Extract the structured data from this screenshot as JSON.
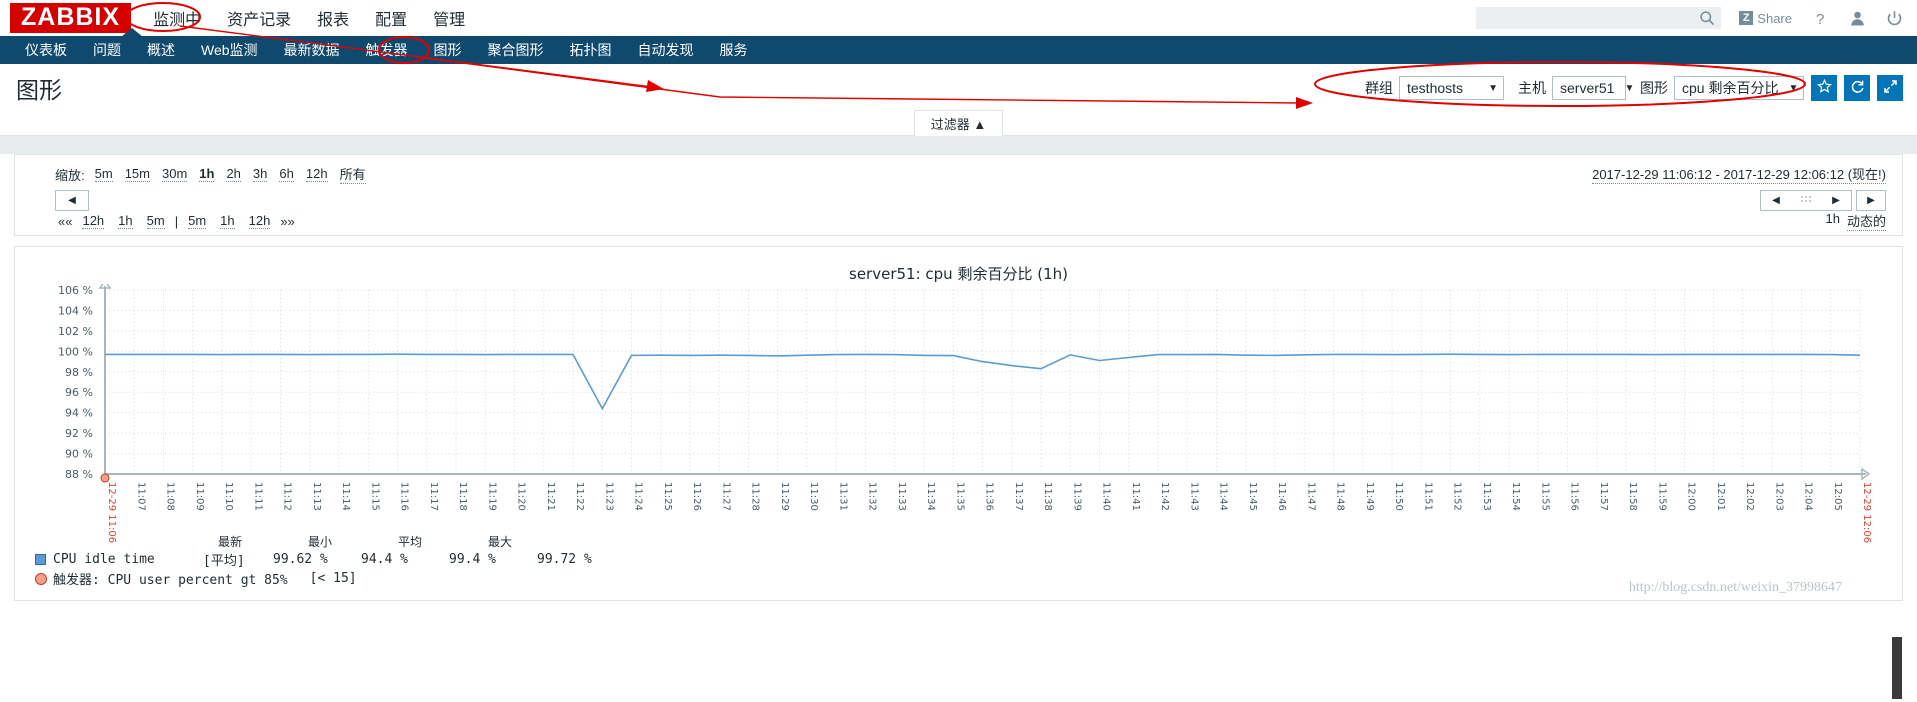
{
  "brand": {
    "logo": "ZABBIX"
  },
  "top_menu": [
    {
      "label": "监测中",
      "active": true,
      "name": "monitoring"
    },
    {
      "label": "资产记录",
      "active": false,
      "name": "inventory"
    },
    {
      "label": "报表",
      "active": false,
      "name": "reports"
    },
    {
      "label": "配置",
      "active": false,
      "name": "configuration"
    },
    {
      "label": "管理",
      "active": false,
      "name": "administration"
    }
  ],
  "search": {
    "value": "",
    "placeholder": ""
  },
  "share": {
    "label": "Share",
    "badge": "Z"
  },
  "sub_menu": [
    {
      "label": "仪表板",
      "active": false
    },
    {
      "label": "问题",
      "active": false
    },
    {
      "label": "概述",
      "active": false
    },
    {
      "label": "Web监测",
      "active": false
    },
    {
      "label": "最新数据",
      "active": false
    },
    {
      "label": "触发器",
      "active": false
    },
    {
      "label": "图形",
      "active": true
    },
    {
      "label": "聚合图形",
      "active": false
    },
    {
      "label": "拓扑图",
      "active": false
    },
    {
      "label": "自动发现",
      "active": false
    },
    {
      "label": "服务",
      "active": false
    }
  ],
  "page": {
    "title": "图形"
  },
  "filters": {
    "group": {
      "label": "群组",
      "value": "testhosts"
    },
    "host": {
      "label": "主机",
      "value": "server51"
    },
    "graph": {
      "label": "图形",
      "value": "cpu 剩余百分比"
    },
    "favorite_icon": "star-icon",
    "refresh_icon": "refresh-icon",
    "fullscreen_icon": "fullscreen-icon"
  },
  "filter_tab": {
    "label": "过滤器 ▲"
  },
  "timecontrol": {
    "zoom_label": "缩放:",
    "zoom_options": [
      {
        "label": "5m",
        "selected": false
      },
      {
        "label": "15m",
        "selected": false
      },
      {
        "label": "30m",
        "selected": false
      },
      {
        "label": "1h",
        "selected": true
      },
      {
        "label": "2h",
        "selected": false
      },
      {
        "label": "3h",
        "selected": false
      },
      {
        "label": "6h",
        "selected": false
      },
      {
        "label": "12h",
        "selected": false
      },
      {
        "label": "所有",
        "selected": false
      }
    ],
    "date_range": "2017-12-29 11:06:12 - 2017-12-29 12:06:12 (现在!)",
    "back_button": "◀",
    "quick_nav": [
      "««",
      "12h",
      "1h",
      "5m",
      "|",
      "5m",
      "1h",
      "12h",
      "»»"
    ],
    "scroll_left": "◀",
    "scroll_handle": "⋮⋮⋮",
    "scroll_right": "▶",
    "forward_button": "▶",
    "period": "1h",
    "dynamic_label": "动态的"
  },
  "graph": {
    "title": "server51: cpu 剩余百分比 (1h)",
    "legend_headers": [
      "最新",
      "最小",
      "平均",
      "最大"
    ],
    "series_row": {
      "name": "CPU idle time",
      "aggregate": "[平均]",
      "last": "99.62 %",
      "min": "94.4 %",
      "avg": "99.4 %",
      "max": "99.72 %"
    },
    "trigger_row": {
      "label": "触发器: CPU user percent gt 85%",
      "value": "[< 15]"
    }
  },
  "watermark": "http://blog.csdn.net/weixin_37998647",
  "chart_data": {
    "type": "line",
    "title": "server51: cpu 剩余百分比 (1h)",
    "xlabel": "",
    "ylabel": "%",
    "ylim": [
      88,
      106
    ],
    "grid": true,
    "legend_position": "bottom-left",
    "y_ticks": [
      "106 %",
      "104 %",
      "102 %",
      "100 %",
      "98 %",
      "96 %",
      "94 %",
      "92 %",
      "90 %",
      "88 %"
    ],
    "x_start_label": "12-29 11:06",
    "x_end_label": "12-29 12:06",
    "x_tick_labels": [
      "12-29 11:06",
      "11:07",
      "11:08",
      "11:09",
      "11:10",
      "11:11",
      "11:12",
      "11:13",
      "11:14",
      "11:15",
      "11:16",
      "11:17",
      "11:18",
      "11:19",
      "11:20",
      "11:21",
      "11:22",
      "11:23",
      "11:24",
      "11:25",
      "11:26",
      "11:27",
      "11:28",
      "11:29",
      "11:30",
      "11:31",
      "11:32",
      "11:33",
      "11:34",
      "11:35",
      "11:36",
      "11:37",
      "11:38",
      "11:39",
      "11:40",
      "11:41",
      "11:42",
      "11:43",
      "11:44",
      "11:45",
      "11:46",
      "11:47",
      "11:48",
      "11:49",
      "11:50",
      "11:51",
      "11:52",
      "11:53",
      "11:54",
      "11:55",
      "11:56",
      "11:57",
      "11:58",
      "11:59",
      "12:00",
      "12:01",
      "12:02",
      "12:03",
      "12:04",
      "12:05",
      "12-29 12:06"
    ],
    "series": [
      {
        "name": "CPU idle time",
        "color": "#5b9bd1",
        "values": [
          99.7,
          99.7,
          99.7,
          99.7,
          99.68,
          99.7,
          99.7,
          99.68,
          99.7,
          99.7,
          99.72,
          99.7,
          99.7,
          99.68,
          99.7,
          99.7,
          99.7,
          94.4,
          99.6,
          99.62,
          99.6,
          99.62,
          99.6,
          99.55,
          99.62,
          99.68,
          99.7,
          99.68,
          99.6,
          99.58,
          99.0,
          98.6,
          98.3,
          99.65,
          99.1,
          99.4,
          99.68,
          99.68,
          99.7,
          99.62,
          99.6,
          99.66,
          99.7,
          99.7,
          99.68,
          99.7,
          99.72,
          99.7,
          99.68,
          99.7,
          99.7,
          99.7,
          99.7,
          99.68,
          99.7,
          99.7,
          99.7,
          99.7,
          99.7,
          99.68,
          99.62
        ]
      }
    ],
    "stats": {
      "last": 99.62,
      "min": 94.4,
      "avg": 99.4,
      "max": 99.72
    }
  }
}
